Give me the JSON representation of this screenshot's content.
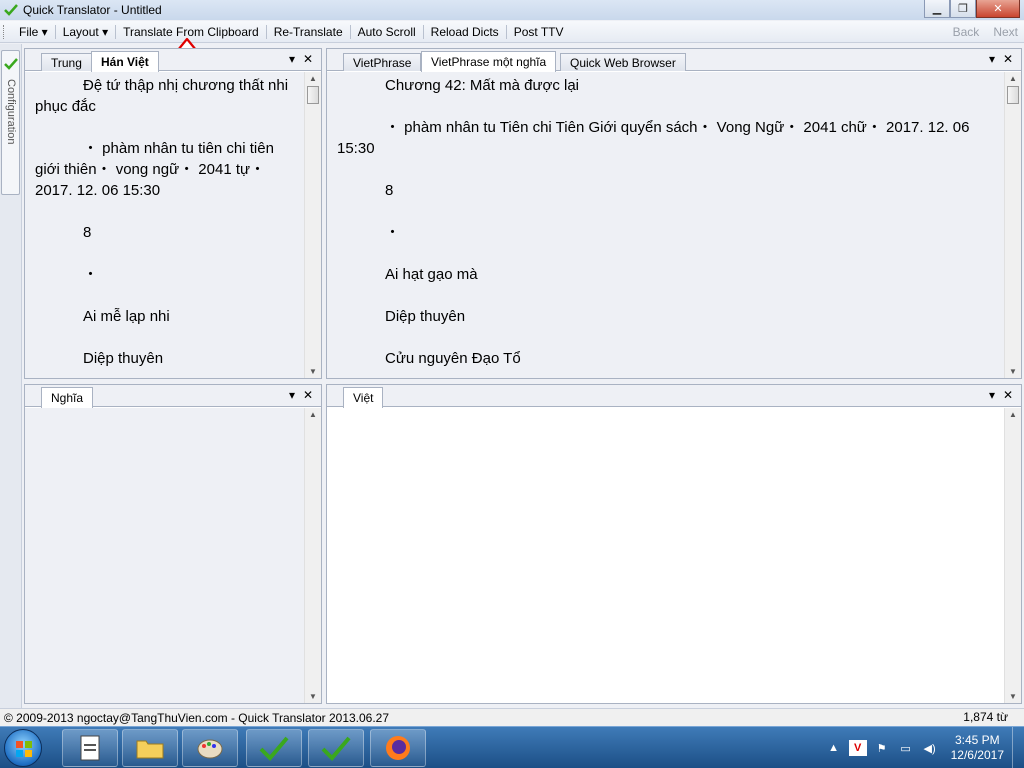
{
  "window": {
    "title": "Quick Translator - Untitled",
    "controls": {
      "minimize": "▁",
      "maximize": "❐",
      "close": "✕"
    }
  },
  "menu": {
    "file": "File ▾",
    "layout": "Layout ▾",
    "translate_clipboard": "Translate From Clipboard",
    "re_translate": "Re-Translate",
    "auto_scroll": "Auto Scroll",
    "reload_dicts": "Reload Dicts",
    "post_ttv": "Post TTV",
    "back": "Back",
    "next": "Next"
  },
  "rail": {
    "label": "Configuration",
    "icon": "check-icon"
  },
  "panels": {
    "top_left": {
      "tabs": [
        "Trung",
        "Hán Việt"
      ],
      "active": "Hán Việt",
      "paragraphs": [
        "Đệ tứ thập nhị chương thất nhi phục đắc",
        "・ phàm nhân tu tiên chi tiên giới thiên・ vong ngữ・ 2041 tự・ 2017. 12. 06 15:30",
        "8",
        "・",
        "Ai mễ lạp nhi",
        "Diệp thuyên"
      ]
    },
    "top_right": {
      "tabs": [
        "VietPhrase",
        "VietPhrase một nghĩa",
        "Quick Web Browser"
      ],
      "active": "VietPhrase một nghĩa",
      "paragraphs": [
        "Chương 42: Mất mà được lại",
        "・ phàm nhân tu Tiên chi Tiên Giới quyển sách・ Vong Ngữ・ 2041 chữ・ 2017. 12. 06 15:30",
        "8",
        "・",
        "Ai hạt gạo mà",
        "Diệp thuyên",
        "Cửu nguyên Đạo Tổ"
      ]
    },
    "bottom_left": {
      "tabs": [
        "Nghĩa"
      ],
      "active": "Nghĩa"
    },
    "bottom_right": {
      "tabs": [
        "Việt"
      ],
      "active": "Việt"
    },
    "controls": {
      "dropdown": "▾",
      "close": "✕"
    }
  },
  "status": {
    "left": "© 2009-2013 ngoctay@TangThuVien.com - Quick Translator 2013.06.27",
    "right": "1,874 từ"
  },
  "taskbar": {
    "time": "3:45 PM",
    "date": "12/6/2017",
    "apps": [
      "notepad-icon",
      "explorer-icon",
      "paint-icon",
      "quicktranslator-icon",
      "quicktranslator-icon",
      "firefox-icon"
    ]
  },
  "colors": {
    "accent_arrow": "#e00000",
    "check_green": "#3aa81e"
  }
}
